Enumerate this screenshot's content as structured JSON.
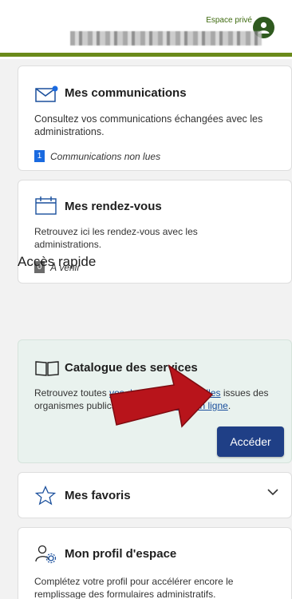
{
  "header": {
    "espace_label": "Espace privé"
  },
  "communications": {
    "title": "Mes communications",
    "desc": "Consultez vos communications échangées avec les administrations.",
    "count": "1",
    "count_label": "Communications non lues"
  },
  "rdv": {
    "title": "Mes rendez-vous",
    "desc": "Retrouvez ici les rendez-vous avec les administrations.",
    "count": "0",
    "count_label": "À venir"
  },
  "quick": {
    "title": "Accès rapide"
  },
  "catalog": {
    "title": "Catalogue des services",
    "desc_1": "Retrouvez toutes ",
    "link_1": "vos données personnelles",
    "desc_2": " issues des organismes publics et les ",
    "link_2": "démarches en ligne",
    "desc_3": ".",
    "button": "Accéder"
  },
  "favoris": {
    "title": "Mes favoris"
  },
  "profil": {
    "title": "Mon profil d'espace",
    "desc": "Complétez votre profil pour accélérer encore le remplissage des formulaires administratifs."
  },
  "colors": {
    "brand_green": "#6a8a1a",
    "button_blue": "#1f3f86",
    "link_blue": "#1a4f9c",
    "arrow_red": "#b8141b"
  }
}
